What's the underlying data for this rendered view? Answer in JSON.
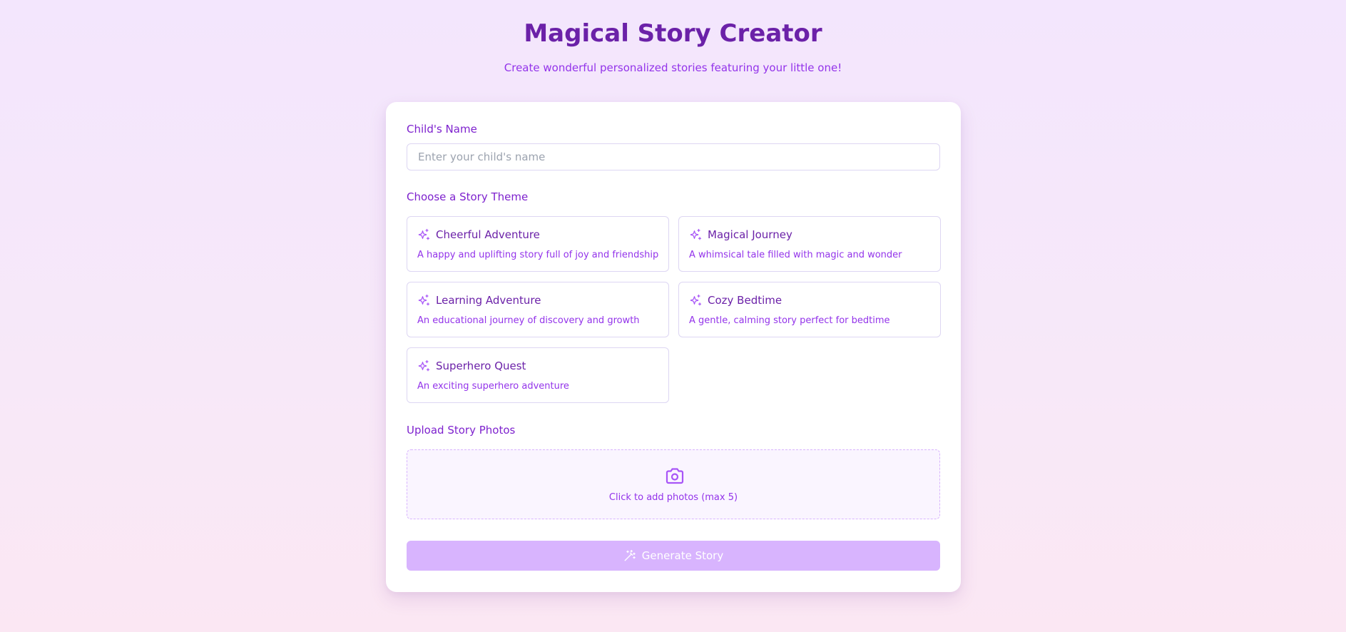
{
  "header": {
    "title": "Magical Story Creator",
    "subtitle": "Create wonderful personalized stories featuring your little one!"
  },
  "form": {
    "name_label": "Child's Name",
    "name_placeholder": "Enter your child's name",
    "name_value": "",
    "theme_label": "Choose a Story Theme",
    "themes": [
      {
        "name": "Cheerful Adventure",
        "description": "A happy and uplifting story full of joy and friendship",
        "icon": "sparkles-icon"
      },
      {
        "name": "Magical Journey",
        "description": "A whimsical tale filled with magic and wonder",
        "icon": "sparkles-icon"
      },
      {
        "name": "Learning Adventure",
        "description": "An educational journey of discovery and growth",
        "icon": "sparkles-icon"
      },
      {
        "name": "Cozy Bedtime",
        "description": "A gentle, calming story perfect for bedtime",
        "icon": "sparkles-icon"
      },
      {
        "name": "Superhero Quest",
        "description": "An exciting superhero adventure",
        "icon": "sparkles-icon"
      }
    ],
    "upload_label": "Upload Story Photos",
    "upload_text": "Click to add photos (max 5)",
    "upload_icon": "camera-icon",
    "generate_label": "Generate Story",
    "generate_icon": "magic-wand-icon"
  },
  "colors": {
    "title": "#6b21a8",
    "accent": "#9333ea",
    "button_disabled": "#d8b4fe",
    "card": "#ffffff"
  }
}
